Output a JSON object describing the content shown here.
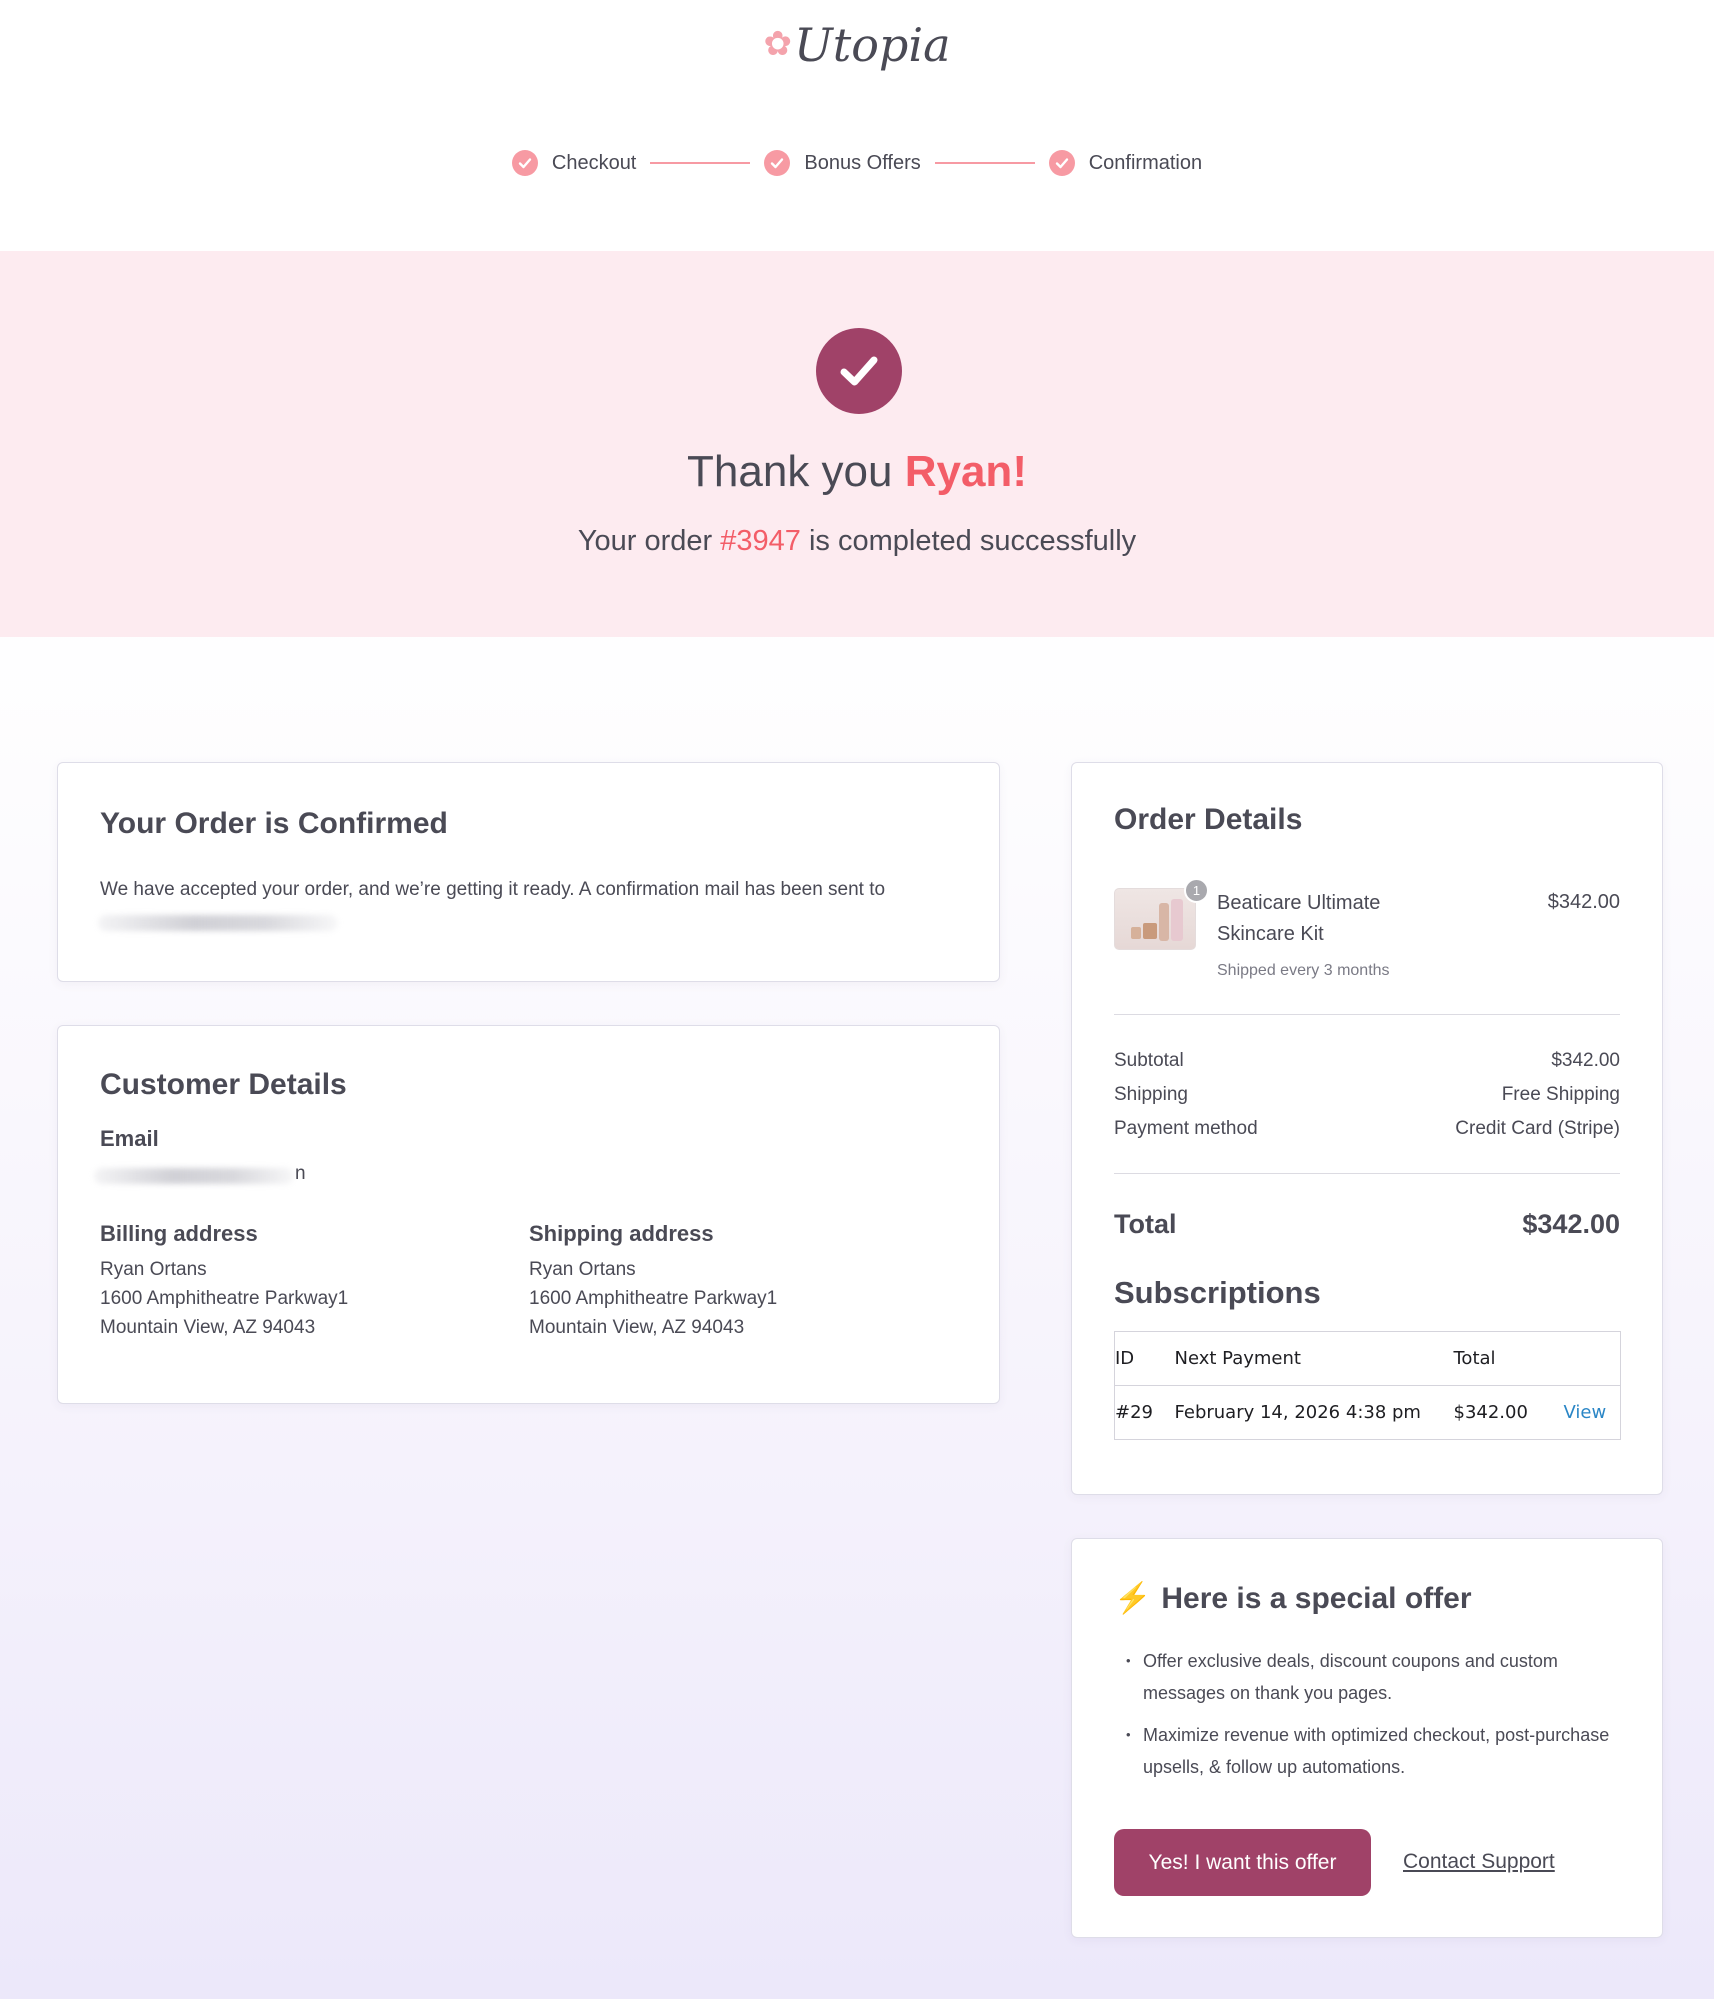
{
  "brand": {
    "name": "Utopia",
    "accent": "#a04268",
    "highlight": "#f35d68",
    "step_color": "#f79aa3"
  },
  "steps": [
    {
      "label": "Checkout",
      "state": "complete"
    },
    {
      "label": "Bonus Offers",
      "state": "complete"
    },
    {
      "label": "Confirmation",
      "state": "complete"
    }
  ],
  "hero": {
    "thanks_prefix": "Thank you ",
    "customer_name": "Ryan!",
    "order_prefix": "Your order ",
    "order_number": "#3947",
    "order_suffix": " is completed successfully"
  },
  "confirmed": {
    "title": "Your Order is Confirmed",
    "message": "We have accepted your order, and we’re getting it ready. A confirmation mail has been sent to"
  },
  "customer": {
    "title": "Customer Details",
    "email_label": "Email",
    "email_visible_tail": "n",
    "billing": {
      "label": "Billing address",
      "name": "Ryan Ortans",
      "line1": "1600 Amphitheatre Parkway1",
      "line2": "Mountain View, AZ 94043"
    },
    "shipping": {
      "label": "Shipping address",
      "name": "Ryan Ortans",
      "line1": "1600 Amphitheatre Parkway1",
      "line2": "Mountain View, AZ 94043"
    }
  },
  "order": {
    "title": "Order Details",
    "item": {
      "name": "Beaticare Ultimate Skincare Kit",
      "price": "$342.00",
      "note": "Shipped every 3 months",
      "quantity": "1"
    },
    "summary": [
      {
        "label": "Subtotal",
        "value": "$342.00"
      },
      {
        "label": "Shipping",
        "value": "Free Shipping"
      },
      {
        "label": "Payment method",
        "value": "Credit Card (Stripe)"
      }
    ],
    "total_label": "Total",
    "total_value": "$342.00"
  },
  "subscriptions": {
    "title": "Subscriptions",
    "headers": [
      "ID",
      "Next Payment",
      "Total"
    ],
    "rows": [
      {
        "id": "#29",
        "next_payment": "February 14, 2026 4:38 pm",
        "total": "$342.00",
        "action": "View"
      }
    ]
  },
  "offer": {
    "title": "Here is a special offer",
    "bullets": [
      "Offer exclusive deals, discount coupons and custom messages on thank you pages.",
      "Maximize revenue with optimized checkout, post-purchase upsells, & follow up automations."
    ],
    "cta_label": "Yes! I want this offer",
    "support_label": "Contact Support"
  }
}
